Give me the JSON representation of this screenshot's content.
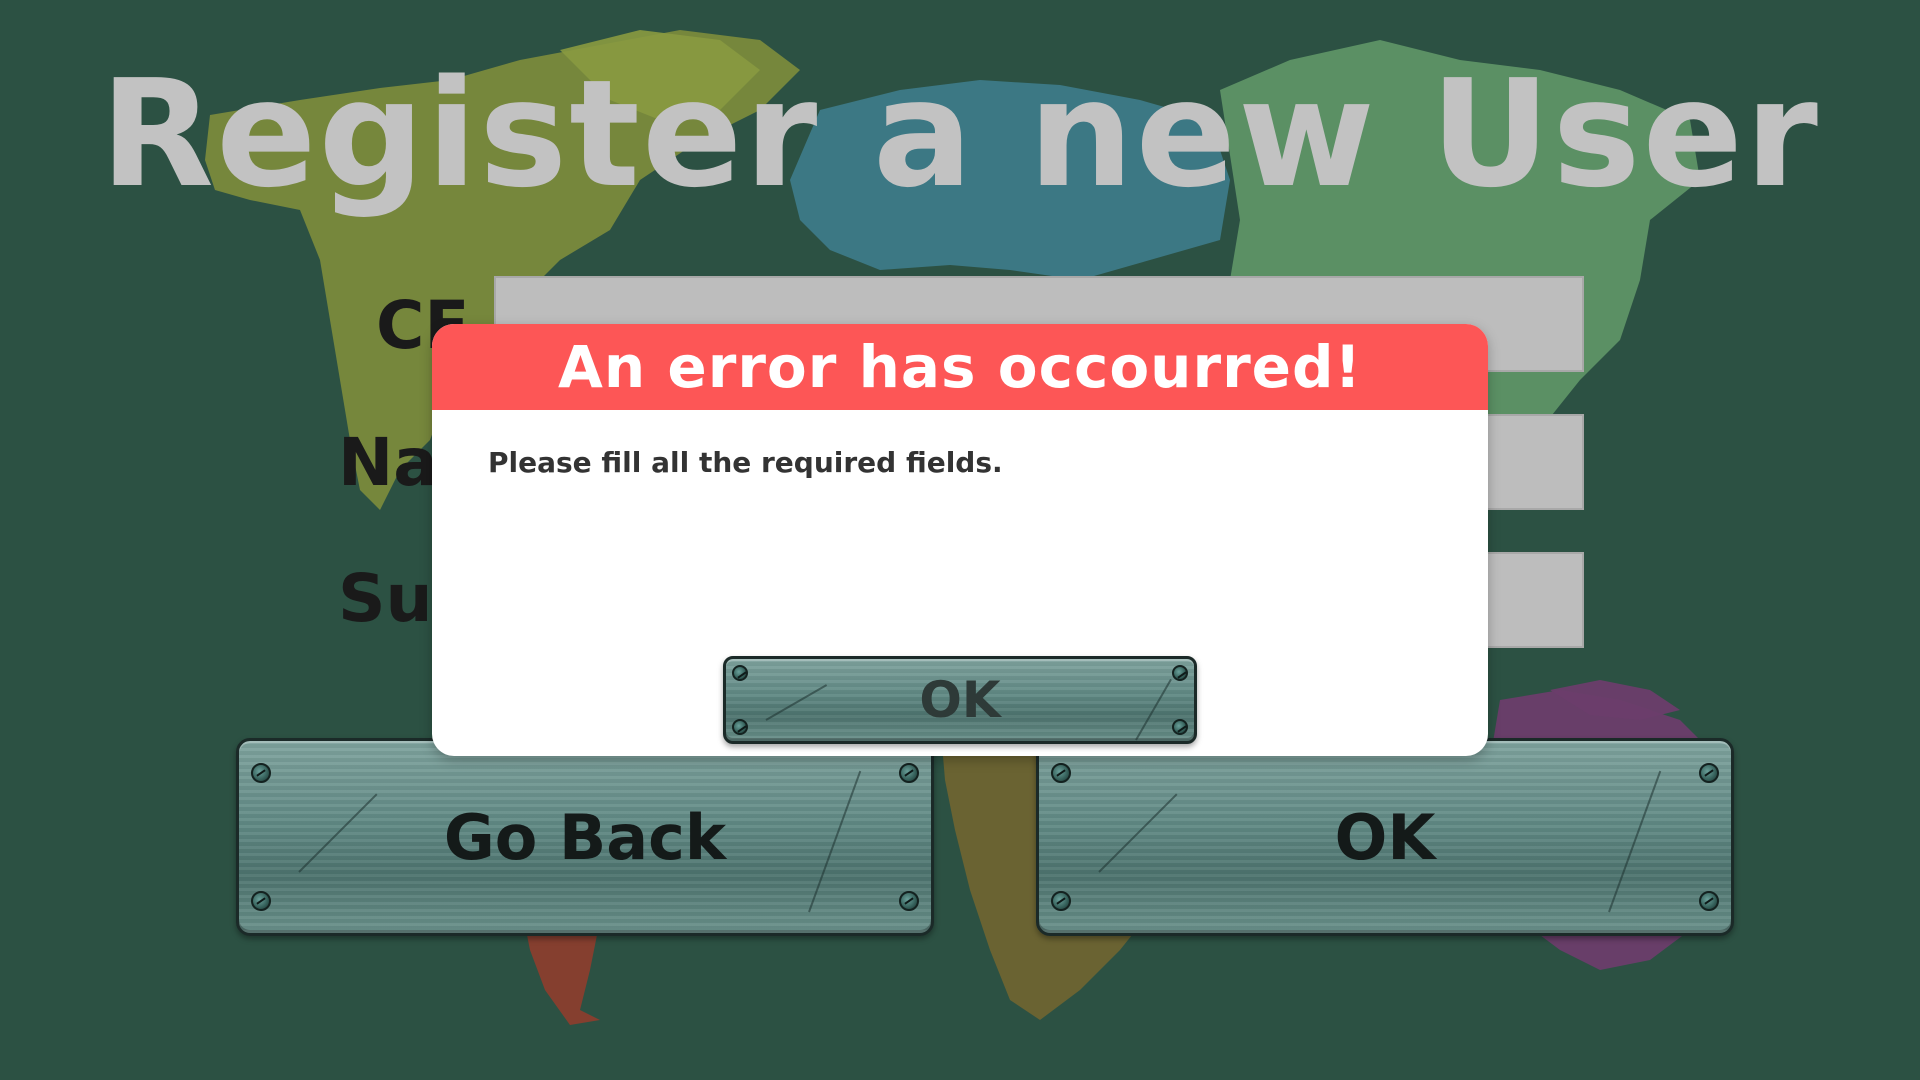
{
  "screen": {
    "title": "Register a new User"
  },
  "form": {
    "fields": [
      {
        "label": "CF",
        "value": ""
      },
      {
        "label": "Name",
        "value": ""
      },
      {
        "label": "Surname",
        "value": ""
      }
    ]
  },
  "buttons": {
    "go_back": "Go Back",
    "ok": "OK"
  },
  "dialog": {
    "title": "An error has occourred!",
    "message": "Please fill all the required fields.",
    "ok_label": "OK",
    "header_color": "#fd5656"
  },
  "colors": {
    "background": "#2c5143",
    "title_text": "#c2c2c2",
    "input_fill": "#bdbdbd"
  },
  "map_regions": [
    "north-america",
    "south-america",
    "europe",
    "africa",
    "asia",
    "oceania"
  ]
}
